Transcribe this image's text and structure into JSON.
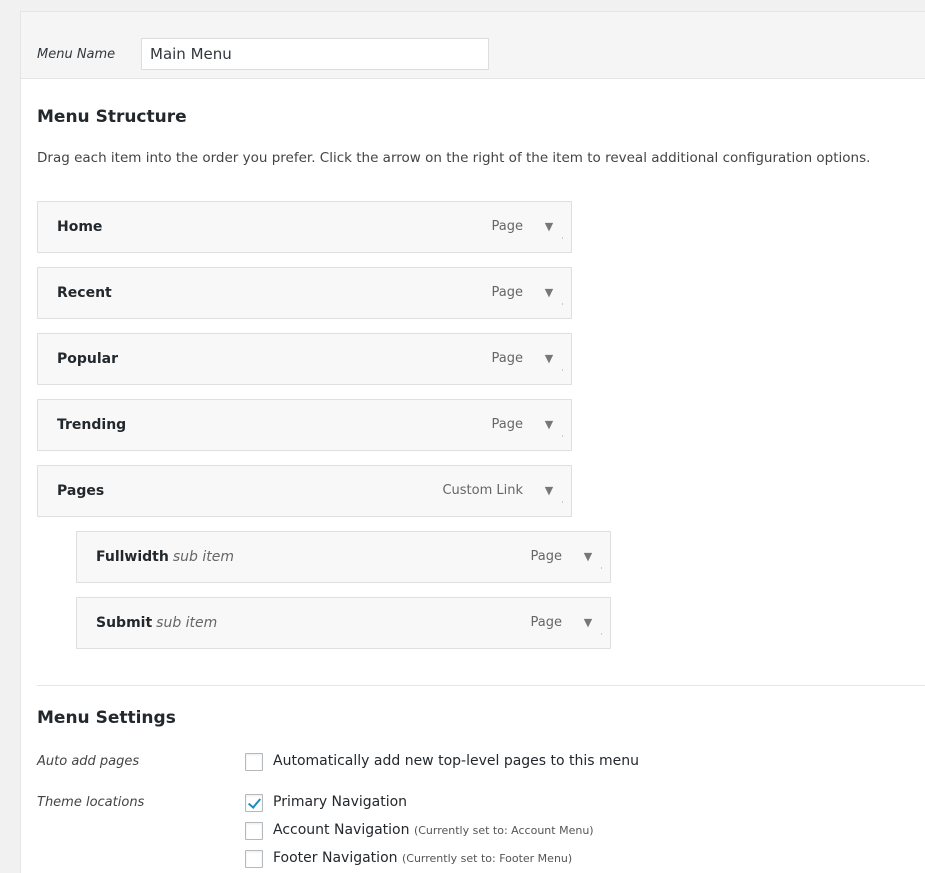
{
  "menu_name": {
    "label": "Menu Name",
    "value": "Main Menu"
  },
  "structure": {
    "title": "Menu Structure",
    "description": "Drag each item into the order you prefer. Click the arrow on the right of the item to reveal additional configuration options.",
    "items": [
      {
        "title": "Home",
        "sub": "",
        "type": "Page"
      },
      {
        "title": "Recent",
        "sub": "",
        "type": "Page"
      },
      {
        "title": "Popular",
        "sub": "",
        "type": "Page"
      },
      {
        "title": "Trending",
        "sub": "",
        "type": "Page"
      },
      {
        "title": "Pages",
        "sub": "",
        "type": "Custom Link"
      },
      {
        "title": "Fullwidth",
        "sub": "sub item",
        "type": "Page"
      },
      {
        "title": "Submit",
        "sub": "sub item",
        "type": "Page"
      }
    ],
    "arrow_glyph": "▼"
  },
  "settings": {
    "title": "Menu Settings",
    "auto_add": {
      "label": "Auto add pages",
      "option": "Automatically add new top-level pages to this menu",
      "checked": false
    },
    "theme_locations": {
      "label": "Theme locations",
      "options": [
        {
          "label": "Primary Navigation",
          "note": "",
          "checked": true
        },
        {
          "label": "Account Navigation",
          "note": "(Currently set to: Account Menu)",
          "checked": false
        },
        {
          "label": "Footer Navigation",
          "note": "(Currently set to: Footer Menu)",
          "checked": false
        }
      ]
    }
  },
  "colors": {
    "checkmark": "#1e8cbe",
    "item_bg": "#f8f8f8",
    "page_bg": "#f1f1f1"
  }
}
